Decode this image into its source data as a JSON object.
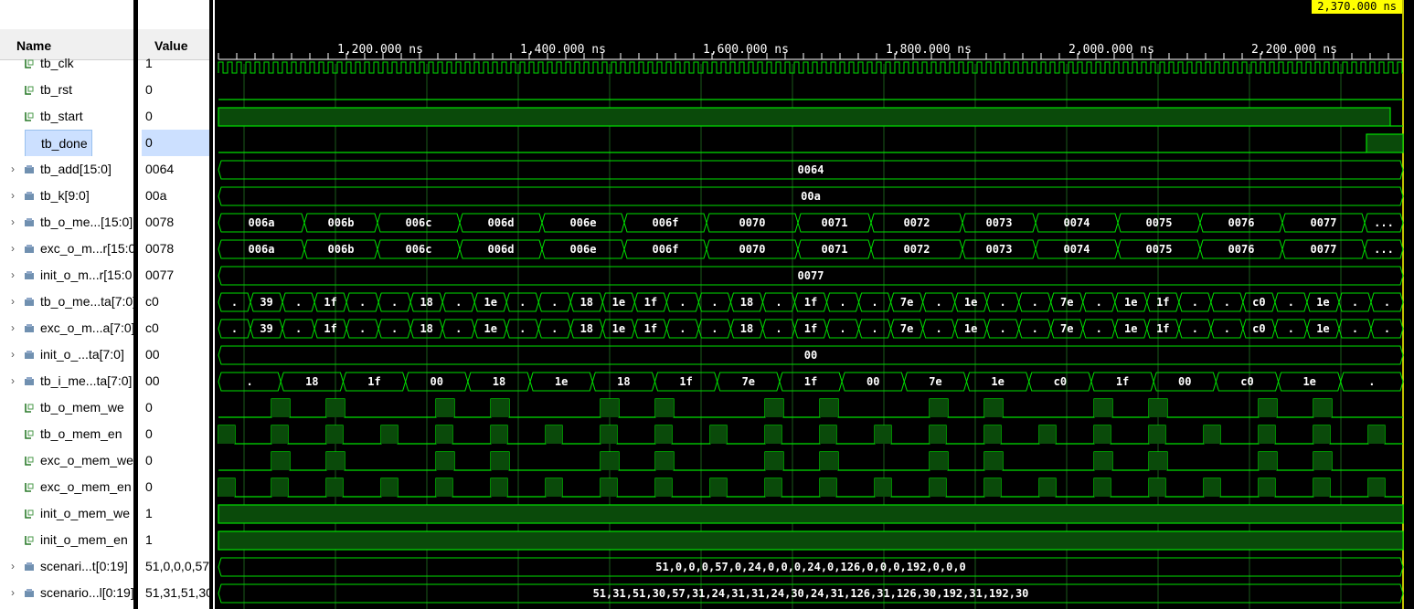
{
  "header": {
    "name_col": "Name",
    "value_col": "Value"
  },
  "cursor": {
    "time": "2,370.000 ns"
  },
  "timeline": {
    "ticks": [
      "1,200.000 ns",
      "1,400.000 ns",
      "1,600.000 ns",
      "1,800.000 ns",
      "2,000.000 ns",
      "2,200.000 ns"
    ]
  },
  "signals": [
    {
      "name": "tb_clk",
      "value": "1",
      "kind": "bit",
      "expandable": false
    },
    {
      "name": "tb_rst",
      "value": "0",
      "kind": "bit",
      "expandable": false
    },
    {
      "name": "tb_start",
      "value": "0",
      "kind": "bit",
      "expandable": false
    },
    {
      "name": "tb_done",
      "value": "0",
      "kind": "bit",
      "expandable": false,
      "selected": true
    },
    {
      "name": "tb_add[15:0]",
      "value": "0064",
      "kind": "bus",
      "expandable": true
    },
    {
      "name": "tb_k[9:0]",
      "value": "00a",
      "kind": "bus",
      "expandable": true
    },
    {
      "name": "tb_o_me...[15:0]",
      "value": "0078",
      "kind": "bus",
      "expandable": true
    },
    {
      "name": "exc_o_m...r[15:0",
      "value": "0078",
      "kind": "bus",
      "expandable": true
    },
    {
      "name": "init_o_m...r[15:0",
      "value": "0077",
      "kind": "bus",
      "expandable": true
    },
    {
      "name": "tb_o_me...ta[7:0]",
      "value": "c0",
      "kind": "bus",
      "expandable": true
    },
    {
      "name": "exc_o_m...a[7:0]",
      "value": "c0",
      "kind": "bus",
      "expandable": true
    },
    {
      "name": "init_o_...ta[7:0]",
      "value": "00",
      "kind": "bus",
      "expandable": true
    },
    {
      "name": "tb_i_me...ta[7:0]",
      "value": "00",
      "kind": "bus",
      "expandable": true
    },
    {
      "name": "tb_o_mem_we",
      "value": "0",
      "kind": "bit",
      "expandable": false
    },
    {
      "name": "tb_o_mem_en",
      "value": "0",
      "kind": "bit",
      "expandable": false
    },
    {
      "name": "exc_o_mem_we",
      "value": "0",
      "kind": "bit",
      "expandable": false
    },
    {
      "name": "exc_o_mem_en",
      "value": "0",
      "kind": "bit",
      "expandable": false
    },
    {
      "name": "init_o_mem_we",
      "value": "1",
      "kind": "bit",
      "expandable": false
    },
    {
      "name": "init_o_mem_en",
      "value": "1",
      "kind": "bit",
      "expandable": false
    },
    {
      "name": "scenari...t[0:19]",
      "value": "51,0,0,0,57,",
      "kind": "bus",
      "expandable": true
    },
    {
      "name": "scenario...l[0:19]",
      "value": "51,31,51,30",
      "kind": "bus",
      "expandable": true
    }
  ],
  "bus_waves": {
    "tb_add": [
      "0064"
    ],
    "tb_k": [
      "00a"
    ],
    "tb_o_mem_addr": [
      "006a",
      "006b",
      "006c",
      "006d",
      "006e",
      "006f",
      "0070",
      "0071",
      "0072",
      "0073",
      "0074",
      "0075",
      "0076",
      "0077",
      "..."
    ],
    "exc_o_mem_addr": [
      "006a",
      "006b",
      "006c",
      "006d",
      "006e",
      "006f",
      "0070",
      "0071",
      "0072",
      "0073",
      "0074",
      "0075",
      "0076",
      "0077",
      "..."
    ],
    "init_o_mem_addr": [
      "0077"
    ],
    "tb_o_mem_data": [
      ".",
      "39",
      ".",
      "1f",
      ".",
      ".",
      "18",
      ".",
      "1e",
      ".",
      ".",
      "18",
      "1e",
      "1f",
      ".",
      ".",
      "18",
      ".",
      "1f",
      ".",
      ".",
      "7e",
      ".",
      "1e",
      ".",
      ".",
      "7e",
      ".",
      "1e",
      "1f",
      ".",
      ".",
      "c0",
      ".",
      "1e",
      ".",
      "."
    ],
    "exc_o_mem_data": [
      ".",
      "39",
      ".",
      "1f",
      ".",
      ".",
      "18",
      ".",
      "1e",
      ".",
      ".",
      "18",
      "1e",
      "1f",
      ".",
      ".",
      "18",
      ".",
      "1f",
      ".",
      ".",
      "7e",
      ".",
      "1e",
      ".",
      ".",
      "7e",
      ".",
      "1e",
      "1f",
      ".",
      ".",
      "c0",
      ".",
      "1e",
      ".",
      "."
    ],
    "init_o_mem_data": [
      "00"
    ],
    "tb_i_mem_data": [
      ".",
      "18",
      "1f",
      "00",
      "18",
      "1e",
      "18",
      "1f",
      "7e",
      "1f",
      "00",
      "7e",
      "1e",
      "c0",
      "1f",
      "00",
      "c0",
      "1e",
      "."
    ],
    "scenario_input": [
      "51,0,0,0,57,0,24,0,0,0,24,0,126,0,0,0,192,0,0,0"
    ],
    "scenario_full": [
      "51,31,51,30,57,31,24,31,31,24,30,24,31,126,31,126,30,192,31,192,30"
    ]
  },
  "colors": {
    "wave": "#00e000",
    "fill": "#0a4a0a",
    "grid": "#1a5a1a",
    "cursor": "#ffff00",
    "bus_text": "#ffffff"
  }
}
